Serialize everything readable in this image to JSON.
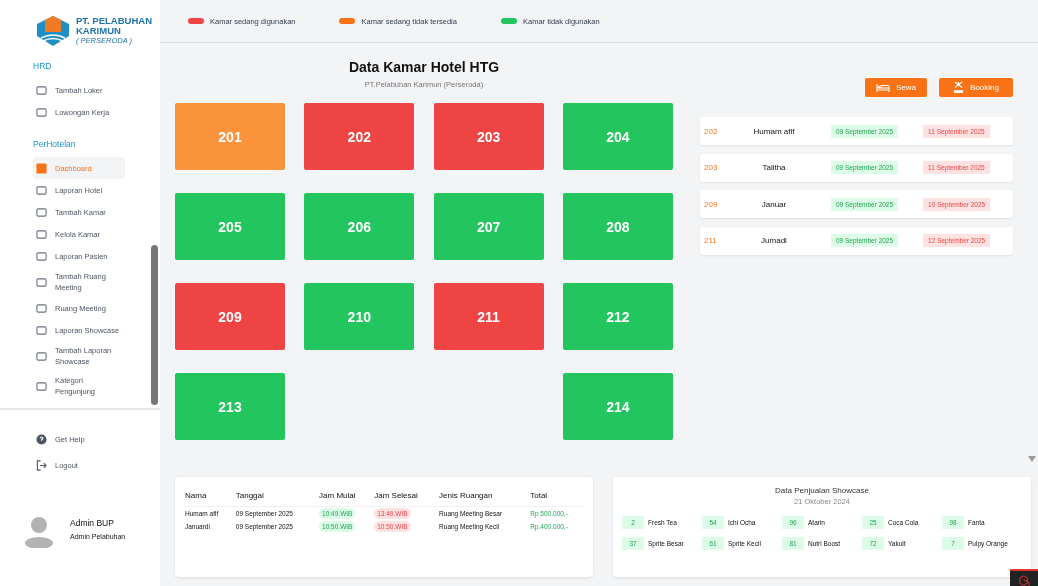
{
  "sidebar": {
    "logo": {
      "line1": "PT. PELABUHAN",
      "line2": "KARIMUN",
      "line3": "( PERSERODA )"
    },
    "sections": [
      {
        "title": "HRD",
        "items": [
          {
            "label": "Tambah Loker",
            "selected": false
          },
          {
            "label": "Lowongan Kerja",
            "selected": false
          }
        ]
      },
      {
        "title": "PerHotelan",
        "items": [
          {
            "label": "Dashboard",
            "selected": true
          },
          {
            "label": "Laporan Hotel",
            "selected": false
          },
          {
            "label": "Tambah Kamar",
            "selected": false
          },
          {
            "label": "Kelola Kamar",
            "selected": false
          },
          {
            "label": "Laporan Pasien",
            "selected": false
          },
          {
            "label": "Tambah Ruang Meeting",
            "selected": false
          },
          {
            "label": "Ruang Meeting",
            "selected": false
          },
          {
            "label": "Laporan Showcase",
            "selected": false
          },
          {
            "label": "Tambah Laporan Showcase",
            "selected": false
          },
          {
            "label": "Kategori Pengunjung",
            "selected": false
          }
        ]
      }
    ],
    "footer": [
      {
        "label": "Get Help",
        "kind": "help"
      },
      {
        "label": "Logout",
        "kind": "logout"
      }
    ],
    "user": {
      "name": "Admin BUP",
      "role": "Admin Pelabuhan"
    }
  },
  "legend": [
    {
      "label": "Kamar sedang digunakan",
      "color": "#ef4444"
    },
    {
      "label": "Kamar sedang tidak tersedia",
      "color": "#f97316"
    },
    {
      "label": "Kamar tidak digunakan",
      "color": "#22c55e"
    }
  ],
  "title": "Data Kamar Hotel HTG",
  "subtitle": "PT.Pelabuhan Karimun (Perseroda)",
  "room_rows": [
    [
      {
        "number": "201",
        "color": "#fb923c"
      },
      {
        "number": "202",
        "color": "#ef4444"
      },
      {
        "number": "203",
        "color": "#ef4444"
      },
      {
        "number": "204",
        "color": "#22c55e"
      }
    ],
    [
      {
        "number": "205",
        "color": "#22c55e"
      },
      {
        "number": "206",
        "color": "#22c55e"
      },
      {
        "number": "207",
        "color": "#22c55e"
      },
      {
        "number": "208",
        "color": "#22c55e"
      }
    ],
    [
      {
        "number": "209",
        "color": "#ef4444"
      },
      {
        "number": "210",
        "color": "#22c55e"
      },
      {
        "number": "211",
        "color": "#ef4444"
      },
      {
        "number": "212",
        "color": "#22c55e"
      }
    ],
    [
      {
        "number": "213",
        "color": "#22c55e"
      },
      null,
      null,
      {
        "number": "214",
        "color": "#22c55e"
      }
    ]
  ],
  "buttons": [
    {
      "label": "Sewa",
      "kind": "rent"
    },
    {
      "label": "Booking",
      "kind": "booking"
    }
  ],
  "bookings": [
    {
      "room": "202",
      "name": "Humam afif",
      "start": "09 September 2025",
      "end": "11 September 2025"
    },
    {
      "room": "203",
      "name": "Talitha",
      "start": "09 September 2025",
      "end": "11 September 2025"
    },
    {
      "room": "209",
      "name": "Januar",
      "start": "09 September 2025",
      "end": "10 September 2025"
    },
    {
      "room": "211",
      "name": "Jumadi",
      "start": "09 September 2025",
      "end": "12 September 2025"
    }
  ],
  "meetings": {
    "columns": [
      "Nama",
      "Tanggal",
      "Jam Mulai",
      "Jam Selesai",
      "Jenis Ruangan",
      "Total"
    ],
    "rows": [
      [
        "Humam afif",
        "09 September 2025",
        "10:49.WIB",
        "13:49.WIB",
        "Ruang Meeting Besar",
        "Rp.500.000,-"
      ],
      [
        "Januardi",
        "09 September 2025",
        "10:50.WIB",
        "10:50.WIB",
        "Ruang Meeting Kecil",
        "Rp.400.000,-"
      ]
    ]
  },
  "showcase": {
    "title": "Data Penjualan Showcase",
    "date": "21 Oktober 2024",
    "items": [
      {
        "count": "2",
        "name": "Fresh Tea"
      },
      {
        "count": "54",
        "name": "Ichi Ocha"
      },
      {
        "count": "96",
        "name": "Atarin"
      },
      {
        "count": "25",
        "name": "Coca Cola"
      },
      {
        "count": "98",
        "name": "Fanta"
      },
      {
        "count": "37",
        "name": "Sprite Besar"
      },
      {
        "count": "61",
        "name": "Sprite Kecil"
      },
      {
        "count": "81",
        "name": "Nutri Boost"
      },
      {
        "count": "72",
        "name": "Yakult"
      },
      {
        "count": "7",
        "name": "Pulpy Orange"
      }
    ]
  }
}
